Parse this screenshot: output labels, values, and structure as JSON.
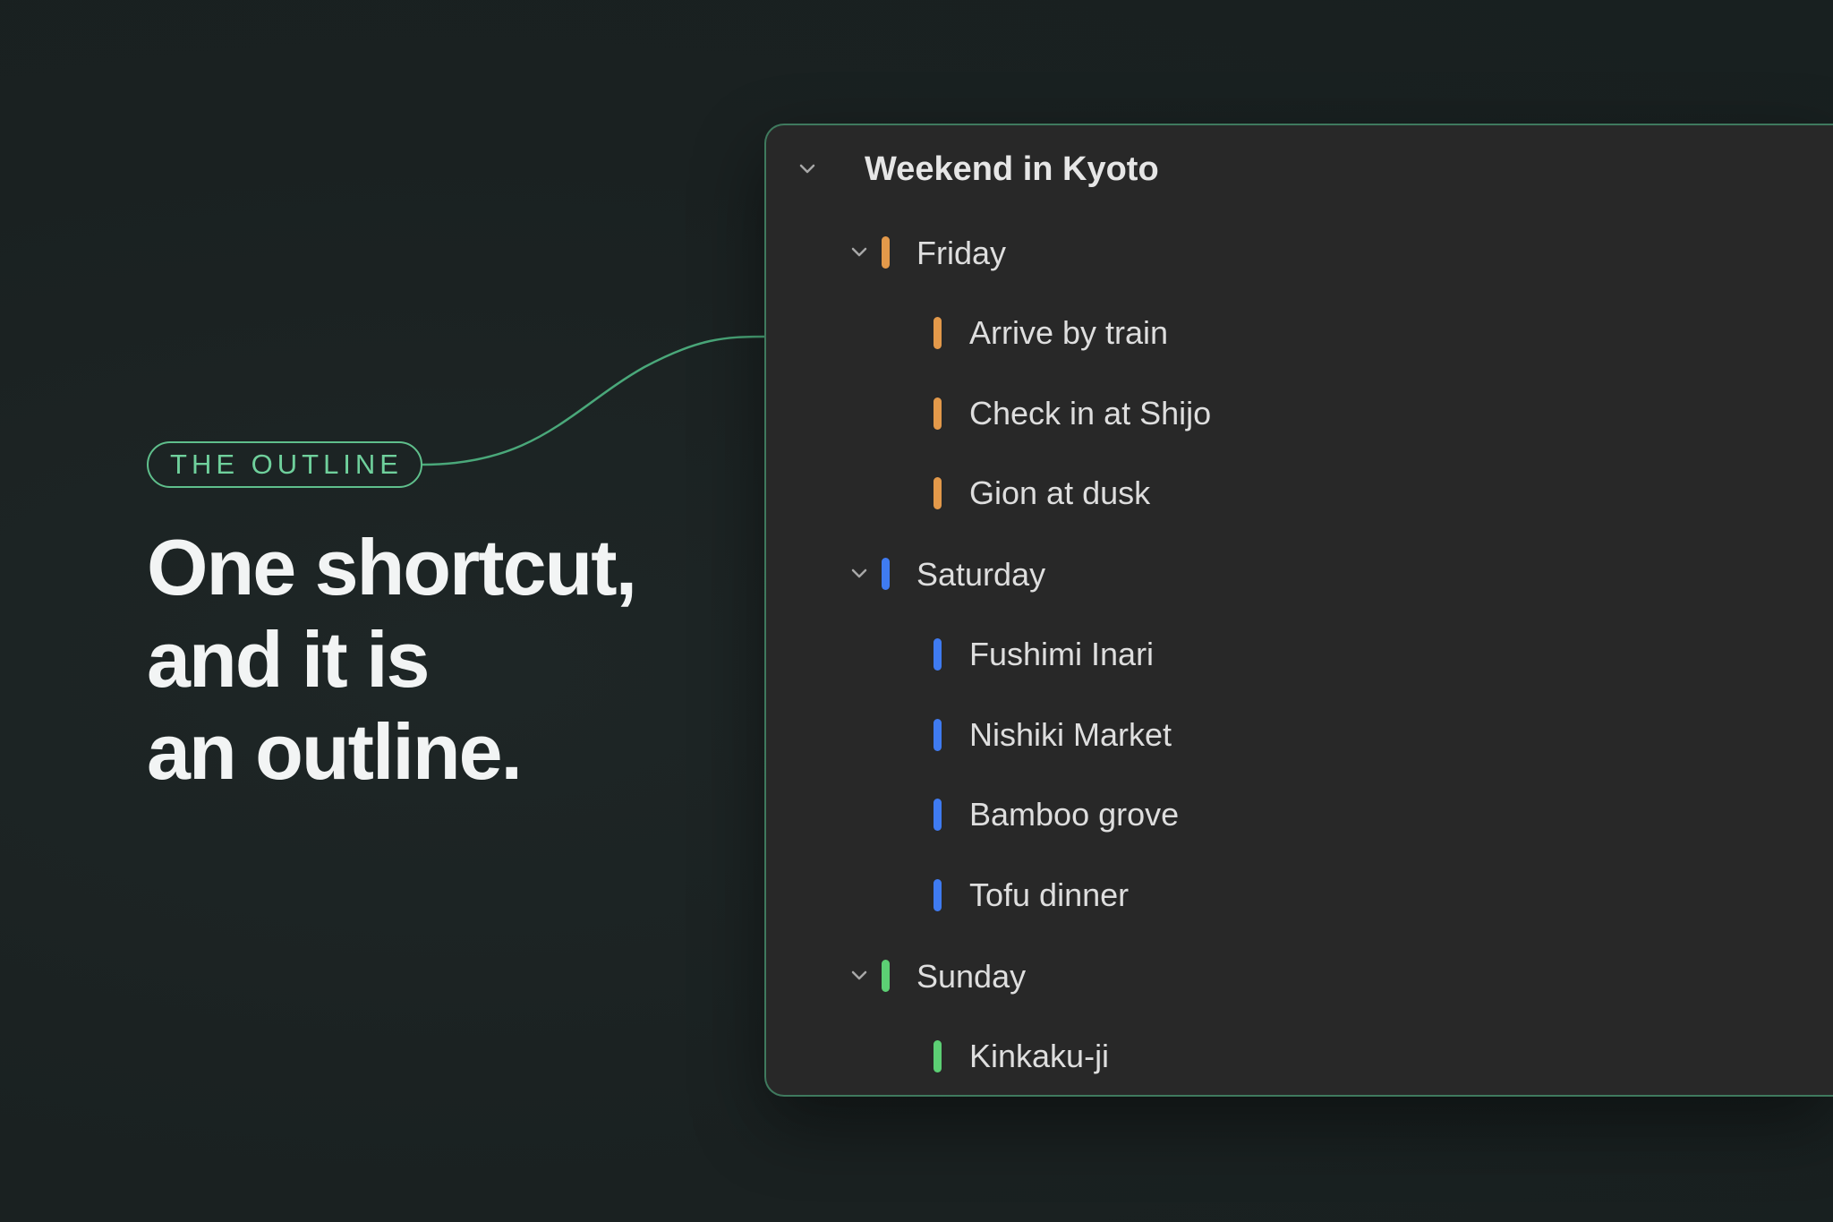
{
  "badge": {
    "label": "THE OUTLINE"
  },
  "headline": {
    "lines": [
      "One shortcut,",
      "and it is",
      "an outline."
    ]
  },
  "outline": {
    "title": "Weekend in Kyoto",
    "days": [
      {
        "label": "Friday",
        "color": "#e3994a",
        "items": [
          "Arrive by train",
          "Check in at Shijo",
          "Gion at dusk"
        ]
      },
      {
        "label": "Saturday",
        "color": "#3f7bf1",
        "items": [
          "Fushimi Inari",
          "Nishiki Market",
          "Bamboo grove",
          "Tofu dinner"
        ]
      },
      {
        "label": "Sunday",
        "color": "#5ccf74",
        "items": [
          "Kinkaku-ji"
        ]
      }
    ]
  },
  "colors": {
    "background": "#1a2020",
    "accent": "#5fbf8c",
    "panel": "#282828",
    "panel_border": "#3f7a5e"
  }
}
